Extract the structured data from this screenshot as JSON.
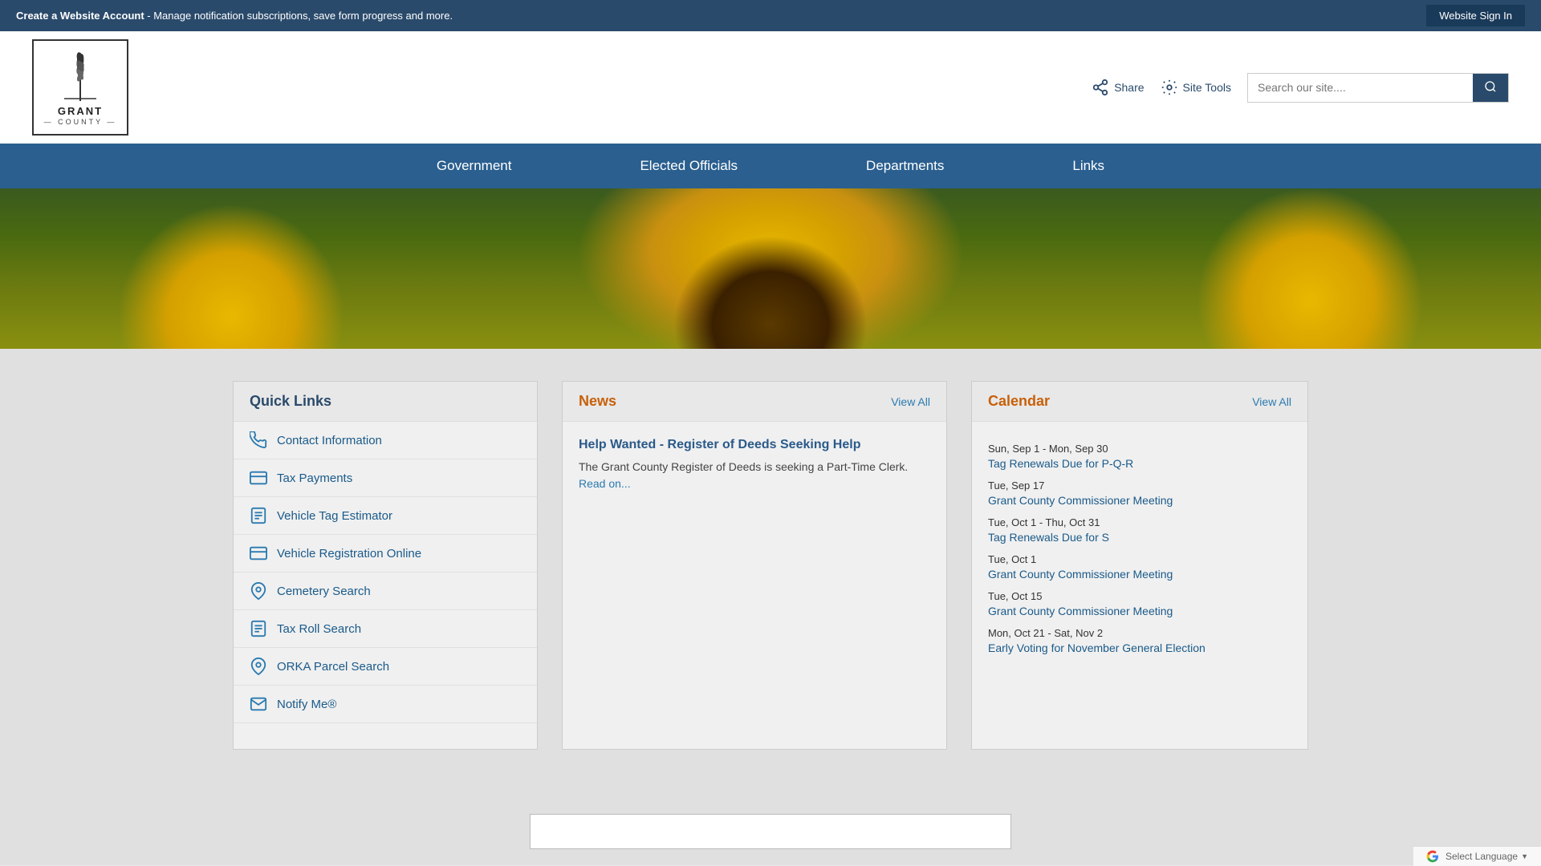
{
  "topbar": {
    "create_account_label": "Create a Website Account",
    "topbar_description": " - Manage notification subscriptions, save form progress and more.",
    "sign_in_label": "Website Sign In"
  },
  "header": {
    "logo_name": "GRANT",
    "logo_sub": "— COUNTY —",
    "share_label": "Share",
    "site_tools_label": "Site Tools",
    "search_placeholder": "Search our site...."
  },
  "nav": {
    "items": [
      {
        "label": "Government"
      },
      {
        "label": "Elected Officials"
      },
      {
        "label": "Departments"
      },
      {
        "label": "Links"
      }
    ]
  },
  "quick_links": {
    "title": "Quick Links",
    "items": [
      {
        "label": "Contact Information",
        "icon": "phone"
      },
      {
        "label": "Tax Payments",
        "icon": "card"
      },
      {
        "label": "Vehicle Tag Estimator",
        "icon": "doc"
      },
      {
        "label": "Vehicle Registration Online",
        "icon": "card"
      },
      {
        "label": "Cemetery Search",
        "icon": "location"
      },
      {
        "label": "Tax Roll Search",
        "icon": "doc"
      },
      {
        "label": "ORKA Parcel Search",
        "icon": "location"
      },
      {
        "label": "Notify Me®",
        "icon": "envelope"
      }
    ]
  },
  "news": {
    "title": "News",
    "view_all": "View All",
    "items": [
      {
        "title": "Help Wanted - Register of Deeds Seeking Help",
        "description": "The Grant County Register of Deeds is seeking a Part-Time Clerk.",
        "read_more": "Read on..."
      }
    ]
  },
  "calendar": {
    "title": "Calendar",
    "view_all": "View All",
    "events": [
      {
        "date": "Sun, Sep 1 - Mon, Sep 30",
        "label": "Tag Renewals Due for P-Q-R"
      },
      {
        "date": "Tue, Sep 17",
        "label": "Grant County Commissioner Meeting"
      },
      {
        "date": "Tue, Oct 1 - Thu, Oct 31",
        "label": "Tag Renewals Due for S"
      },
      {
        "date": "Tue, Oct 1",
        "label": "Grant County Commissioner Meeting"
      },
      {
        "date": "Tue, Oct 15",
        "label": "Grant County Commissioner Meeting"
      },
      {
        "date": "Mon, Oct 21 - Sat, Nov 2",
        "label": "Early Voting for November General Election"
      }
    ]
  },
  "footer": {
    "select_language": "Select Language"
  }
}
